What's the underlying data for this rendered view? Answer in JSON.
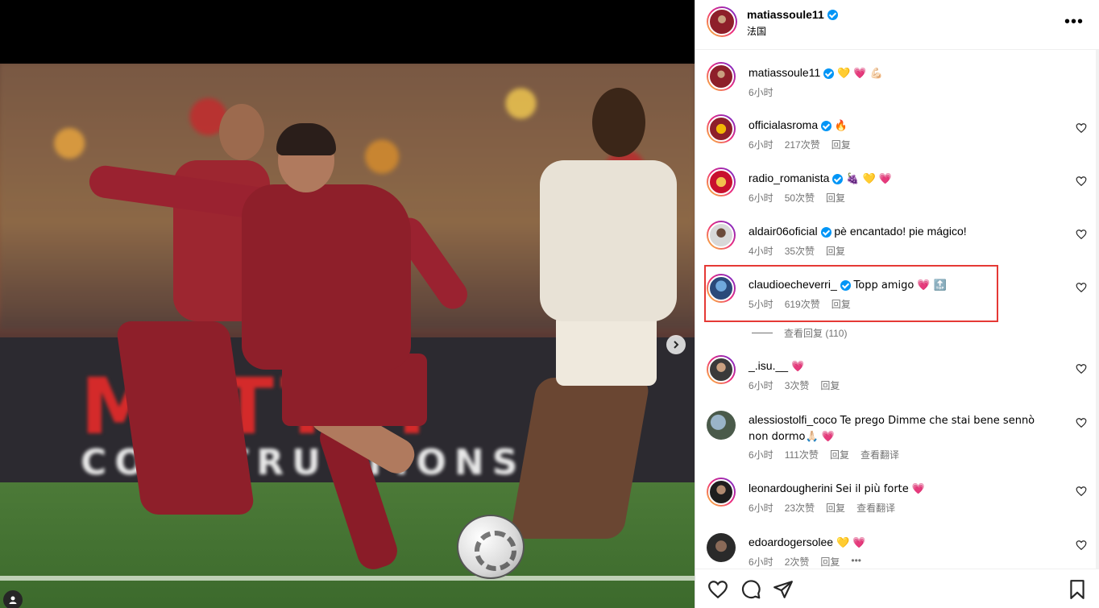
{
  "post": {
    "author": "matiassoule11",
    "location": "法国",
    "more_label": "•••"
  },
  "media": {
    "board_text": "MATTTI",
    "board_sub": "CONSTRUCTIONS",
    "next_label": "›"
  },
  "comments": [
    {
      "user": "matiassoule11",
      "verified": true,
      "text": "💛 💗 💪🏻",
      "time": "6小时",
      "likes": "",
      "reply": "",
      "translate": ""
    },
    {
      "user": "officialasroma",
      "verified": true,
      "text": "🔥",
      "time": "6小时",
      "likes": "217次赞",
      "reply": "回复",
      "translate": ""
    },
    {
      "user": "radio_romanista",
      "verified": true,
      "text": "🍇 💛 💗",
      "time": "6小时",
      "likes": "50次赞",
      "reply": "回复",
      "translate": ""
    },
    {
      "user": "aldair06oficial",
      "verified": true,
      "text": "pè encantado! pie mágico!",
      "time": "4小时",
      "likes": "35次赞",
      "reply": "回复",
      "translate": ""
    },
    {
      "user": "claudioecheverri_",
      "verified": true,
      "text": "Topp amigo 💗 🔝",
      "time": "5小时",
      "likes": "619次赞",
      "reply": "回复",
      "translate": ""
    },
    {
      "user": "_.isu.__",
      "verified": false,
      "text": "💗",
      "time": "6小时",
      "likes": "3次赞",
      "reply": "回复",
      "translate": ""
    },
    {
      "user": "alessiostolfi_coco",
      "verified": false,
      "text": "Te prego Dimme che stai bene sennò non dormo🙏🏻 💗",
      "time": "6小时",
      "likes": "111次赞",
      "reply": "回复",
      "translate": "查看翻译"
    },
    {
      "user": "leonardougherini",
      "verified": false,
      "text": "Sei il più forte 💗",
      "time": "6小时",
      "likes": "23次赞",
      "reply": "回复",
      "translate": "查看翻译"
    },
    {
      "user": "edoardogersolee",
      "verified": false,
      "text": "💛 💗",
      "time": "6小时",
      "likes": "2次赞",
      "reply": "回复",
      "translate": ""
    }
  ],
  "replies_label": "查看回复 (110)",
  "comment_more": "•••",
  "colors": {
    "verified": "#0095f6",
    "highlight": "#e53935",
    "meta": "#737373"
  }
}
